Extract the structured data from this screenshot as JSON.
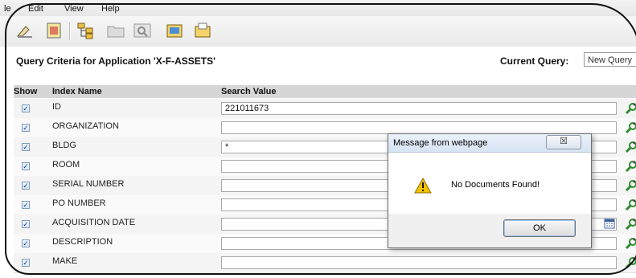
{
  "menu": {
    "items": [
      "le",
      "Edit",
      "View",
      "Help"
    ]
  },
  "toolbar": {
    "icons": [
      "clear-icon",
      "notes-icon",
      "tree-icon",
      "folder-icon",
      "search-icon",
      "export-icon",
      "import-icon"
    ]
  },
  "query": {
    "title": "Query Criteria for Application 'X-F-ASSETS'",
    "current_label": "Current Query:",
    "current_value": "New Query"
  },
  "table": {
    "headers": {
      "show": "Show",
      "index_name": "Index Name",
      "search_value": "Search Value"
    },
    "rows": [
      {
        "name": "ID",
        "value": "221011673",
        "checked": true
      },
      {
        "name": "ORGANIZATION",
        "value": "",
        "checked": true
      },
      {
        "name": "BLDG",
        "value": "*",
        "checked": true
      },
      {
        "name": "ROOM",
        "value": "",
        "checked": true
      },
      {
        "name": "SERIAL NUMBER",
        "value": "",
        "checked": true
      },
      {
        "name": "PO NUMBER",
        "value": "",
        "checked": true
      },
      {
        "name": "ACQUISITION DATE",
        "value": "",
        "checked": true
      },
      {
        "name": "DESCRIPTION",
        "value": "",
        "checked": true
      },
      {
        "name": "MAKE",
        "value": "",
        "checked": true
      }
    ]
  },
  "dialog": {
    "title": "Message from webpage",
    "close_label": "☒",
    "message": "No Documents Found!",
    "ok_label": "OK"
  },
  "colors": {
    "header_bg": "#d6d6d6",
    "go_icon": "#2e8b2e",
    "warning": "#f2c200"
  }
}
